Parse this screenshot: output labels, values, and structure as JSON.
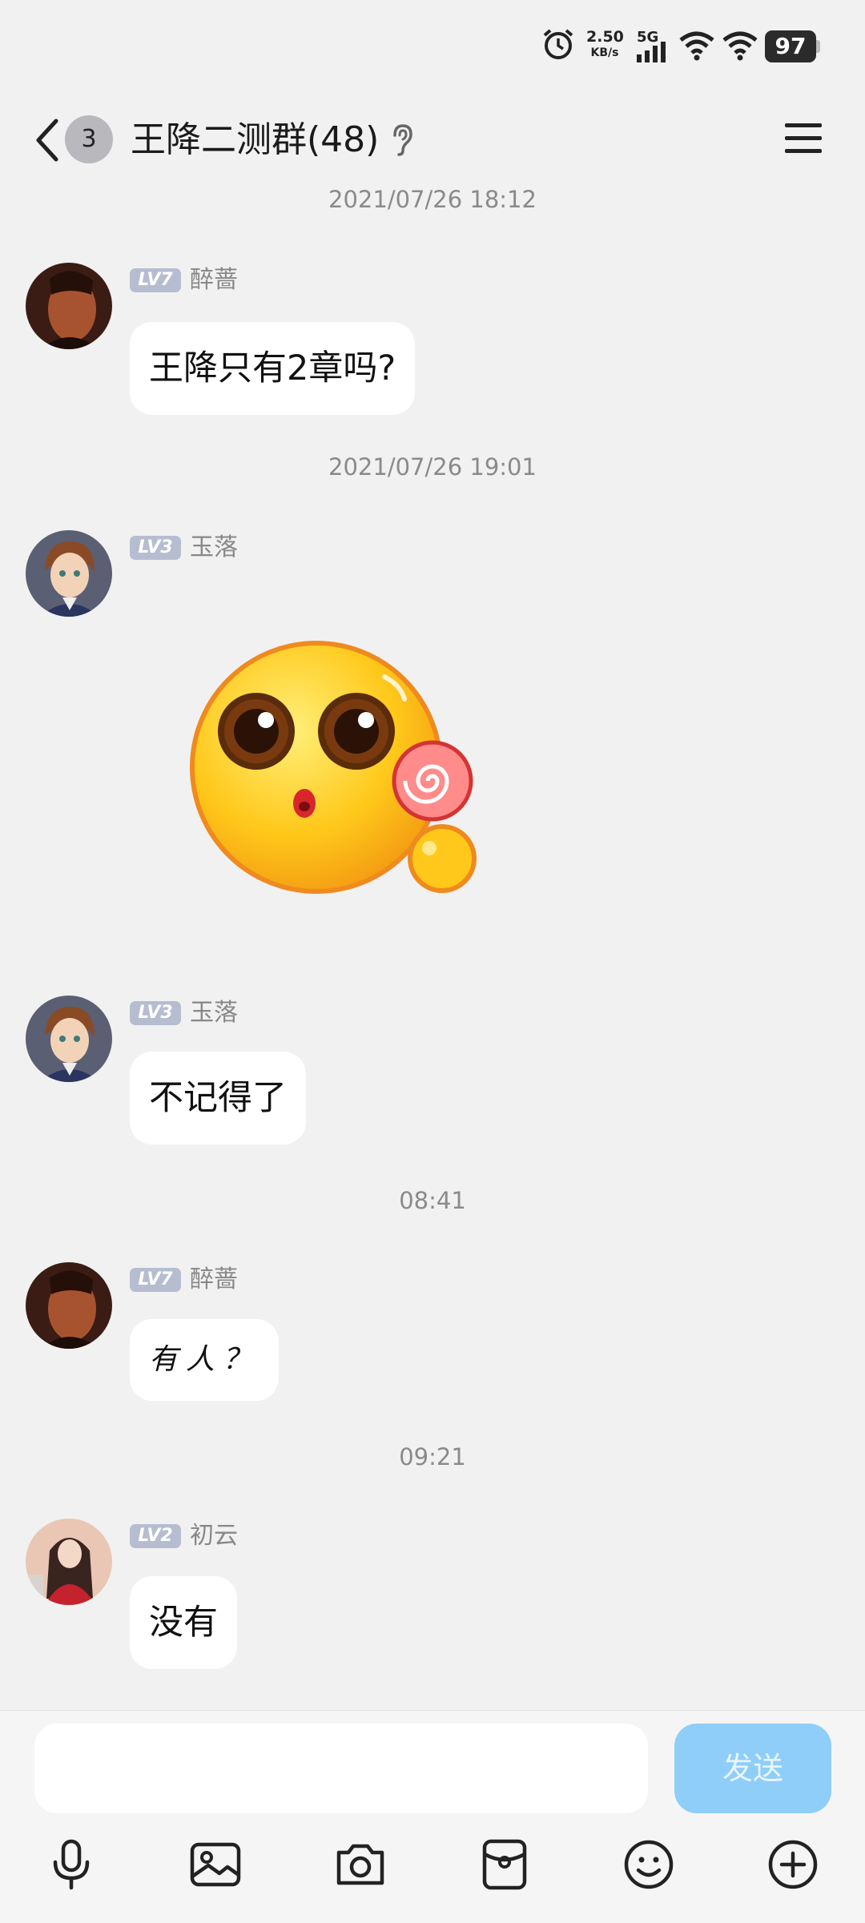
{
  "status_bar": {
    "speed_value": "2.50",
    "speed_unit": "KB/s",
    "network": "5G",
    "battery": "97"
  },
  "header": {
    "unread_count": "3",
    "title": "王降二测群(48)"
  },
  "messages": [
    {
      "type": "time",
      "text": "2021/07/26 18:12"
    },
    {
      "type": "msg",
      "level": "LV7",
      "nick": "醉蔷",
      "text": "王降只有2章吗?"
    },
    {
      "type": "time",
      "text": "2021/07/26 19:01"
    },
    {
      "type": "sticker",
      "level": "LV3",
      "nick": "玉落",
      "sticker": "lollipop-emoji-sticker"
    },
    {
      "type": "msg",
      "level": "LV3",
      "nick": "玉落",
      "text": "不记得了"
    },
    {
      "type": "time",
      "text": "08:41"
    },
    {
      "type": "msg",
      "level": "LV7",
      "nick": "醉蔷",
      "text": "有人？"
    },
    {
      "type": "time",
      "text": "09:21"
    },
    {
      "type": "msg",
      "level": "LV2",
      "nick": "初云",
      "text": "没有"
    }
  ],
  "composer": {
    "input_value": "",
    "send_label": "发送"
  },
  "toolbar_icons": [
    "microphone-icon",
    "image-icon",
    "camera-icon",
    "red-packet-icon",
    "emoji-icon",
    "plus-icon"
  ],
  "colors": {
    "send_button": "#8fcef8",
    "level_badge": "#b6bdd0",
    "background": "#f1f1f1"
  }
}
